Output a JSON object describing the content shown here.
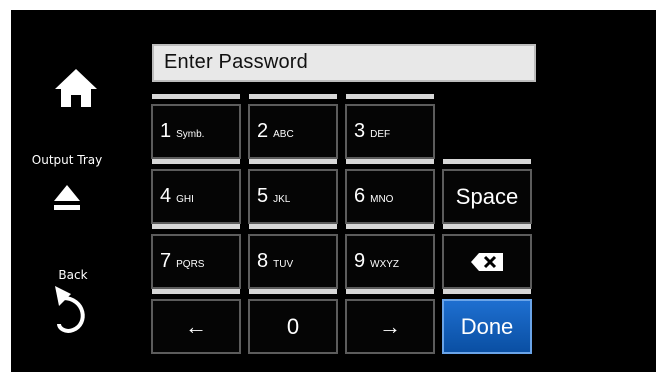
{
  "left_panel": {
    "home_label": "",
    "output_tray_label": "Output Tray",
    "back_label": "Back"
  },
  "password_field": {
    "title": "Enter Password",
    "value": ""
  },
  "keypad": {
    "rows": [
      [
        {
          "num": "1",
          "sub": "Symb."
        },
        {
          "num": "2",
          "sub": "ABC"
        },
        {
          "num": "3",
          "sub": "DEF"
        }
      ],
      [
        {
          "num": "4",
          "sub": "GHI"
        },
        {
          "num": "5",
          "sub": "JKL"
        },
        {
          "num": "6",
          "sub": "MNO"
        }
      ],
      [
        {
          "num": "7",
          "sub": "PQRS"
        },
        {
          "num": "8",
          "sub": "TUV"
        },
        {
          "num": "9",
          "sub": "WXYZ"
        }
      ]
    ],
    "space_label": "Space",
    "left_arrow": "←",
    "zero": "0",
    "right_arrow": "→",
    "done_label": "Done"
  },
  "colors": {
    "done_blue": "#1e6fd0",
    "background": "#000000",
    "field_bg": "#e8e8e8"
  }
}
